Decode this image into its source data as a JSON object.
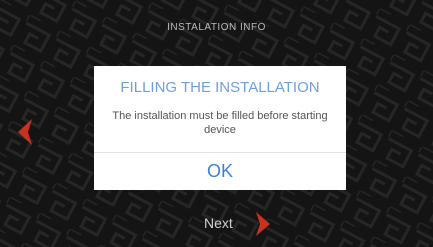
{
  "screen": {
    "title": "INSTALATION INFO"
  },
  "nav": {
    "prev_icon": "chevron-left-icon",
    "next_label": "Next",
    "next_icon": "chevron-right-icon",
    "arrow_color": "#c8331f"
  },
  "dialog": {
    "title": "FILLING THE INSTALLATION",
    "message": "The installation must be filled before starting device",
    "ok_label": "OK",
    "title_color": "#6e9fe0",
    "ok_color": "#3d82d8"
  }
}
